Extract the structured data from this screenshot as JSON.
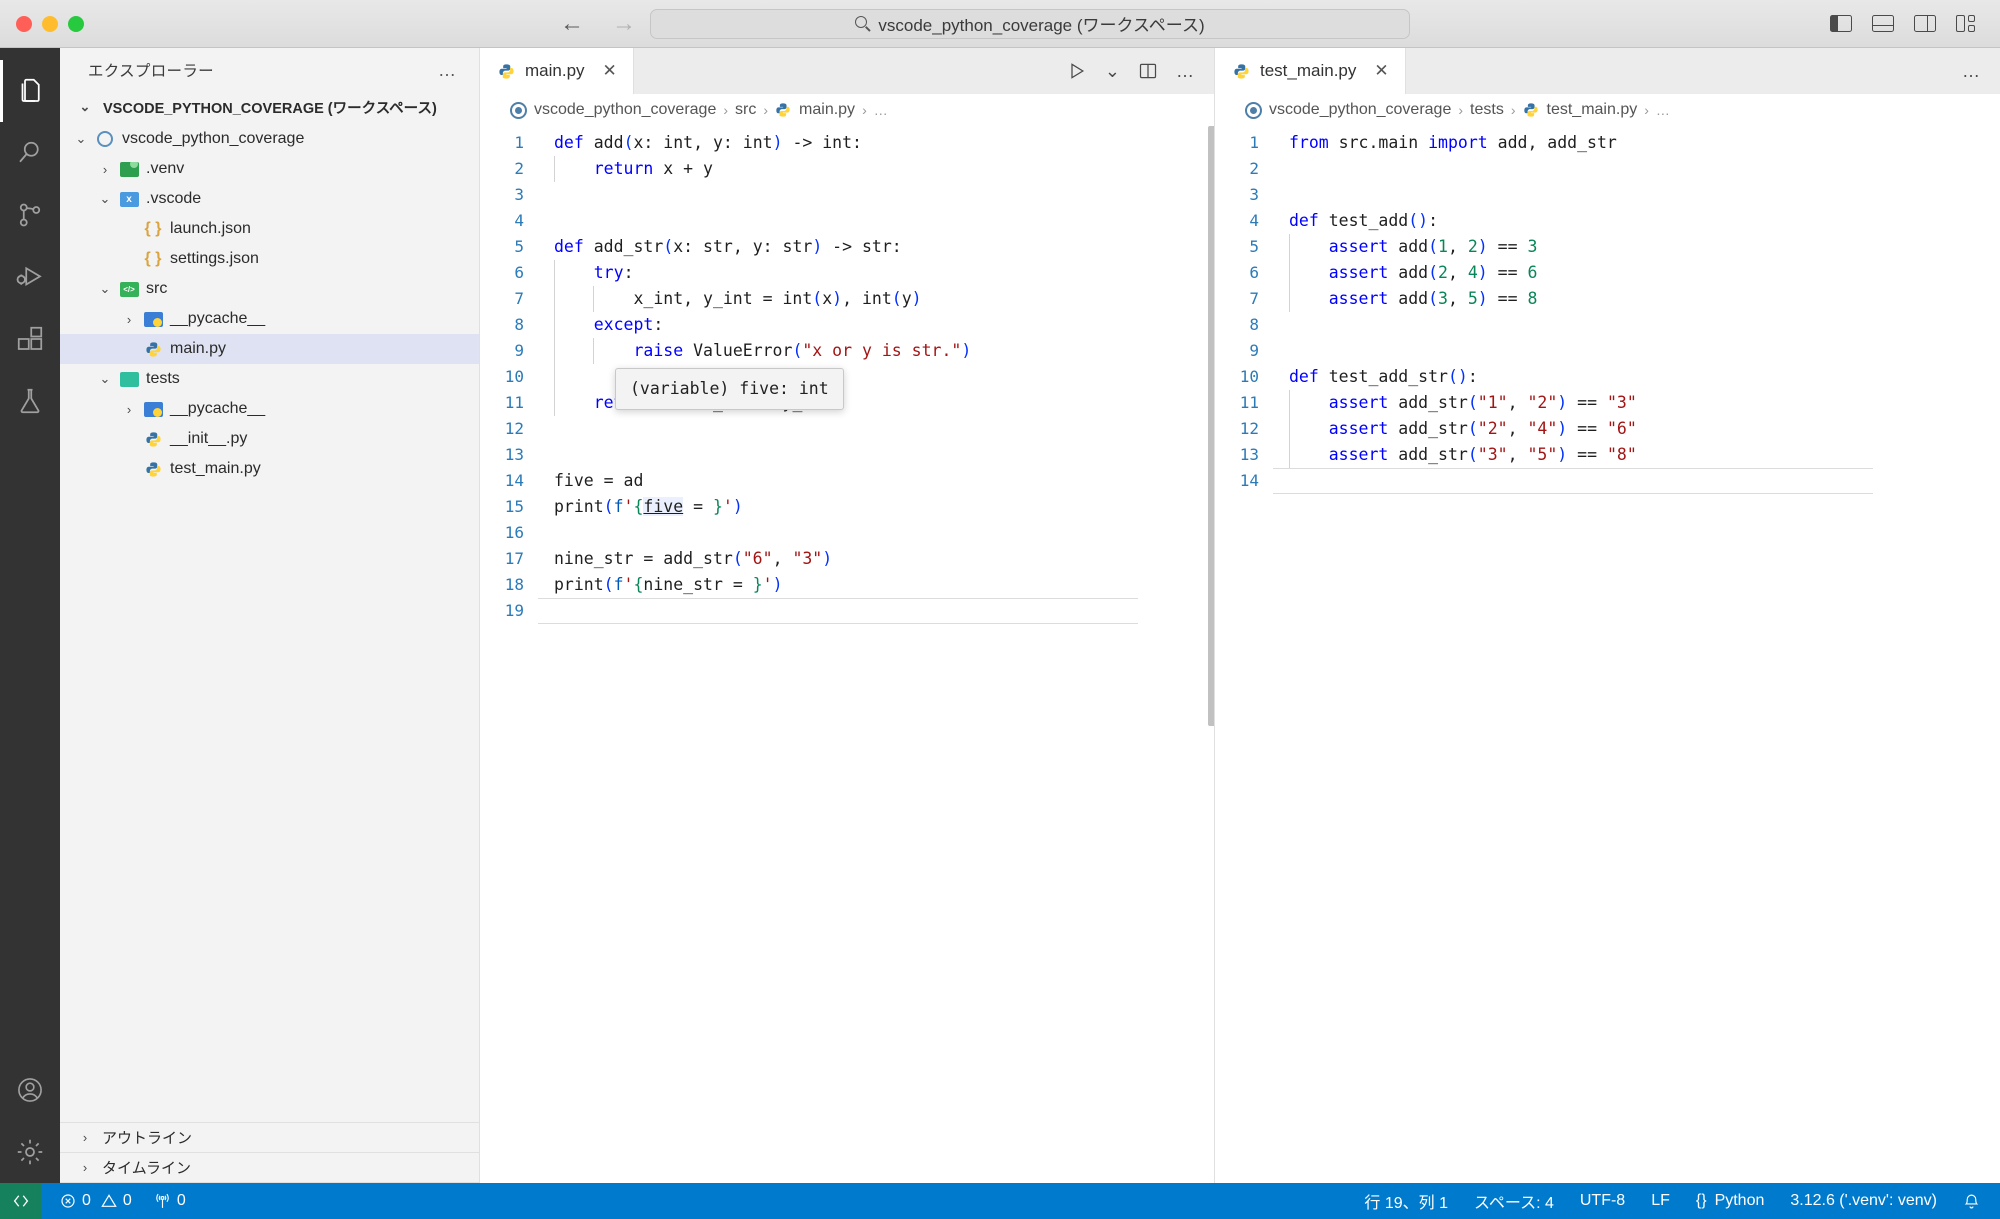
{
  "titlebar": {
    "search_text": "vscode_python_coverage (ワークスペース)",
    "back_label": "←",
    "forward_label": "→",
    "layout_icons": [
      "toggle-primary-sidebar",
      "toggle-panel",
      "toggle-secondary-sidebar",
      "customize-layout"
    ]
  },
  "activitybar": {
    "items": [
      {
        "name": "explorer",
        "active": true
      },
      {
        "name": "search",
        "active": false
      },
      {
        "name": "source-control",
        "active": false
      },
      {
        "name": "run-and-debug",
        "active": false
      },
      {
        "name": "extensions",
        "active": false
      },
      {
        "name": "testing",
        "active": false
      }
    ],
    "bottom": [
      {
        "name": "accounts"
      },
      {
        "name": "manage-settings"
      }
    ]
  },
  "sidebar": {
    "title": "エクスプローラー",
    "more_label": "…",
    "workspace_root": "VSCODE_PYTHON_COVERAGE (ワークスペース)",
    "tree": [
      {
        "label": "vscode_python_coverage",
        "icon": "folder-circle",
        "indent": 1,
        "chevron": "▾",
        "selected": false
      },
      {
        "label": ".venv",
        "icon": "folder-venv",
        "indent": 2,
        "chevron": "›",
        "selected": false
      },
      {
        "label": ".vscode",
        "icon": "folder-vscode",
        "indent": 2,
        "chevron": "▾",
        "selected": false
      },
      {
        "label": "launch.json",
        "icon": "json-braces",
        "indent": 3,
        "chevron": "",
        "selected": false
      },
      {
        "label": "settings.json",
        "icon": "json-braces",
        "indent": 3,
        "chevron": "",
        "selected": false
      },
      {
        "label": "src",
        "icon": "folder-src",
        "indent": 2,
        "chevron": "▾",
        "selected": false
      },
      {
        "label": "__pycache__",
        "icon": "folder-pycache",
        "indent": 3,
        "chevron": "›",
        "selected": false
      },
      {
        "label": "main.py",
        "icon": "python-file",
        "indent": 3,
        "chevron": "",
        "selected": true
      },
      {
        "label": "tests",
        "icon": "folder-tests",
        "indent": 2,
        "chevron": "▾",
        "selected": false
      },
      {
        "label": "__pycache__",
        "icon": "folder-pycache",
        "indent": 3,
        "chevron": "›",
        "selected": false
      },
      {
        "label": "__init__.py",
        "icon": "python-file",
        "indent": 3,
        "chevron": "",
        "selected": false
      },
      {
        "label": "test_main.py",
        "icon": "python-file",
        "indent": 3,
        "chevron": "",
        "selected": false
      }
    ],
    "sections": [
      {
        "label": "アウトライン",
        "chevron": "›"
      },
      {
        "label": "タイムライン",
        "chevron": "›"
      }
    ]
  },
  "editor_groups": [
    {
      "tab": {
        "label": "main.py",
        "icon": "python-file",
        "close": "✕"
      },
      "actions": {
        "run": "run-python-file",
        "run_chevron": "⌄",
        "split": "split-editor",
        "more": "…"
      },
      "breadcrumb": [
        "vscode_python_coverage",
        "src",
        "main.py",
        "…"
      ],
      "tooltip": "(variable) five: int",
      "lines": [
        {
          "n": "1",
          "tokens": [
            {
              "t": "def",
              "c": "kw"
            },
            {
              "t": " add",
              "c": "plain"
            },
            {
              "t": "(",
              "c": "paren"
            },
            {
              "t": "x: int, y: int",
              "c": "plain"
            },
            {
              "t": ")",
              "c": "paren"
            },
            {
              "t": " -> int:",
              "c": "plain"
            }
          ]
        },
        {
          "n": "2",
          "indent": 1,
          "tokens": [
            {
              "t": "    ",
              "c": "plain"
            },
            {
              "t": "return",
              "c": "kw"
            },
            {
              "t": " x + y",
              "c": "plain"
            }
          ]
        },
        {
          "n": "3",
          "tokens": []
        },
        {
          "n": "4",
          "tokens": []
        },
        {
          "n": "5",
          "tokens": [
            {
              "t": "def",
              "c": "kw"
            },
            {
              "t": " add_str",
              "c": "plain"
            },
            {
              "t": "(",
              "c": "paren"
            },
            {
              "t": "x: str, y: str",
              "c": "plain"
            },
            {
              "t": ")",
              "c": "paren"
            },
            {
              "t": " -> str:",
              "c": "plain"
            }
          ]
        },
        {
          "n": "6",
          "indent": 1,
          "tokens": [
            {
              "t": "    ",
              "c": "plain"
            },
            {
              "t": "try",
              "c": "kw"
            },
            {
              "t": ":",
              "c": "plain"
            }
          ]
        },
        {
          "n": "7",
          "indent": 2,
          "tokens": [
            {
              "t": "        x_int, y_int = int",
              "c": "plain"
            },
            {
              "t": "(",
              "c": "paren"
            },
            {
              "t": "x",
              "c": "plain"
            },
            {
              "t": ")",
              "c": "paren"
            },
            {
              "t": ", int",
              "c": "plain"
            },
            {
              "t": "(",
              "c": "paren"
            },
            {
              "t": "y",
              "c": "plain"
            },
            {
              "t": ")",
              "c": "paren"
            }
          ]
        },
        {
          "n": "8",
          "indent": 1,
          "tokens": [
            {
              "t": "    ",
              "c": "plain"
            },
            {
              "t": "except",
              "c": "kw"
            },
            {
              "t": ":",
              "c": "plain"
            }
          ]
        },
        {
          "n": "9",
          "indent": 2,
          "tokens": [
            {
              "t": "        ",
              "c": "plain"
            },
            {
              "t": "raise",
              "c": "kw"
            },
            {
              "t": " ValueError",
              "c": "plain"
            },
            {
              "t": "(",
              "c": "paren"
            },
            {
              "t": "\"x or y is str.\"",
              "c": "str"
            },
            {
              "t": ")",
              "c": "paren"
            }
          ]
        },
        {
          "n": "10",
          "indent": 1,
          "tokens": []
        },
        {
          "n": "11",
          "indent": 1,
          "tokens": [
            {
              "t": "    ",
              "c": "plain"
            },
            {
              "t": "return",
              "c": "kw"
            },
            {
              "t": " str",
              "c": "plain"
            },
            {
              "t": "(",
              "c": "paren"
            },
            {
              "t": "x_int + y_int",
              "c": "plain"
            },
            {
              "t": ")",
              "c": "paren"
            }
          ]
        },
        {
          "n": "12",
          "tokens": []
        },
        {
          "n": "13",
          "tokens": []
        },
        {
          "n": "14",
          "tokens": [
            {
              "t": "five = ad",
              "c": "plain"
            }
          ]
        },
        {
          "n": "15",
          "tokens": [
            {
              "t": "print",
              "c": "plain"
            },
            {
              "t": "(",
              "c": "paren"
            },
            {
              "t": "f",
              "c": "kw2"
            },
            {
              "t": "'",
              "c": "str"
            },
            {
              "t": "{",
              "c": "fstr-brace"
            },
            {
              "t": "five",
              "c": "var-u"
            },
            {
              "t": " = ",
              "c": "plain"
            },
            {
              "t": "}",
              "c": "fstr-brace"
            },
            {
              "t": "'",
              "c": "str"
            },
            {
              "t": ")",
              "c": "paren"
            }
          ]
        },
        {
          "n": "16",
          "tokens": []
        },
        {
          "n": "17",
          "tokens": [
            {
              "t": "nine_str = add_str",
              "c": "plain"
            },
            {
              "t": "(",
              "c": "paren"
            },
            {
              "t": "\"6\"",
              "c": "str"
            },
            {
              "t": ", ",
              "c": "plain"
            },
            {
              "t": "\"3\"",
              "c": "str"
            },
            {
              "t": ")",
              "c": "paren"
            }
          ]
        },
        {
          "n": "18",
          "tokens": [
            {
              "t": "print",
              "c": "plain"
            },
            {
              "t": "(",
              "c": "paren"
            },
            {
              "t": "f",
              "c": "kw2"
            },
            {
              "t": "'",
              "c": "str"
            },
            {
              "t": "{",
              "c": "fstr-brace"
            },
            {
              "t": "nine_str",
              "c": "plain"
            },
            {
              "t": " = ",
              "c": "plain"
            },
            {
              "t": "}",
              "c": "fstr-brace"
            },
            {
              "t": "'",
              "c": "str"
            },
            {
              "t": ")",
              "c": "paren"
            }
          ]
        },
        {
          "n": "19",
          "tokens": [],
          "cursor": true
        }
      ]
    },
    {
      "tab": {
        "label": "test_main.py",
        "icon": "python-file",
        "close": "✕"
      },
      "actions": {
        "more": "…"
      },
      "breadcrumb": [
        "vscode_python_coverage",
        "tests",
        "test_main.py",
        "…"
      ],
      "lines": [
        {
          "n": "1",
          "tokens": [
            {
              "t": "from",
              "c": "kw"
            },
            {
              "t": " src.main ",
              "c": "plain"
            },
            {
              "t": "import",
              "c": "kw"
            },
            {
              "t": " add, add_str",
              "c": "plain"
            }
          ]
        },
        {
          "n": "2",
          "tokens": []
        },
        {
          "n": "3",
          "tokens": []
        },
        {
          "n": "4",
          "tokens": [
            {
              "t": "def",
              "c": "kw"
            },
            {
              "t": " test_add",
              "c": "plain"
            },
            {
              "t": "()",
              "c": "paren"
            },
            {
              "t": ":",
              "c": "plain"
            }
          ]
        },
        {
          "n": "5",
          "indent": 1,
          "tokens": [
            {
              "t": "    ",
              "c": "plain"
            },
            {
              "t": "assert",
              "c": "kw"
            },
            {
              "t": " add",
              "c": "plain"
            },
            {
              "t": "(",
              "c": "paren"
            },
            {
              "t": "1",
              "c": "num"
            },
            {
              "t": ", ",
              "c": "plain"
            },
            {
              "t": "2",
              "c": "num"
            },
            {
              "t": ")",
              "c": "paren"
            },
            {
              "t": " == ",
              "c": "plain"
            },
            {
              "t": "3",
              "c": "num"
            }
          ]
        },
        {
          "n": "6",
          "indent": 1,
          "tokens": [
            {
              "t": "    ",
              "c": "plain"
            },
            {
              "t": "assert",
              "c": "kw"
            },
            {
              "t": " add",
              "c": "plain"
            },
            {
              "t": "(",
              "c": "paren"
            },
            {
              "t": "2",
              "c": "num"
            },
            {
              "t": ", ",
              "c": "plain"
            },
            {
              "t": "4",
              "c": "num"
            },
            {
              "t": ")",
              "c": "paren"
            },
            {
              "t": " == ",
              "c": "plain"
            },
            {
              "t": "6",
              "c": "num"
            }
          ]
        },
        {
          "n": "7",
          "indent": 1,
          "tokens": [
            {
              "t": "    ",
              "c": "plain"
            },
            {
              "t": "assert",
              "c": "kw"
            },
            {
              "t": " add",
              "c": "plain"
            },
            {
              "t": "(",
              "c": "paren"
            },
            {
              "t": "3",
              "c": "num"
            },
            {
              "t": ", ",
              "c": "plain"
            },
            {
              "t": "5",
              "c": "num"
            },
            {
              "t": ")",
              "c": "paren"
            },
            {
              "t": " == ",
              "c": "plain"
            },
            {
              "t": "8",
              "c": "num"
            }
          ]
        },
        {
          "n": "8",
          "tokens": []
        },
        {
          "n": "9",
          "tokens": []
        },
        {
          "n": "10",
          "tokens": [
            {
              "t": "def",
              "c": "kw"
            },
            {
              "t": " test_add_str",
              "c": "plain"
            },
            {
              "t": "()",
              "c": "paren"
            },
            {
              "t": ":",
              "c": "plain"
            }
          ]
        },
        {
          "n": "11",
          "indent": 1,
          "tokens": [
            {
              "t": "    ",
              "c": "plain"
            },
            {
              "t": "assert",
              "c": "kw"
            },
            {
              "t": " add_str",
              "c": "plain"
            },
            {
              "t": "(",
              "c": "paren"
            },
            {
              "t": "\"1\"",
              "c": "str"
            },
            {
              "t": ", ",
              "c": "plain"
            },
            {
              "t": "\"2\"",
              "c": "str"
            },
            {
              "t": ")",
              "c": "paren"
            },
            {
              "t": " == ",
              "c": "plain"
            },
            {
              "t": "\"3\"",
              "c": "str"
            }
          ]
        },
        {
          "n": "12",
          "indent": 1,
          "tokens": [
            {
              "t": "    ",
              "c": "plain"
            },
            {
              "t": "assert",
              "c": "kw"
            },
            {
              "t": " add_str",
              "c": "plain"
            },
            {
              "t": "(",
              "c": "paren"
            },
            {
              "t": "\"2\"",
              "c": "str"
            },
            {
              "t": ", ",
              "c": "plain"
            },
            {
              "t": "\"4\"",
              "c": "str"
            },
            {
              "t": ")",
              "c": "paren"
            },
            {
              "t": " == ",
              "c": "plain"
            },
            {
              "t": "\"6\"",
              "c": "str"
            }
          ]
        },
        {
          "n": "13",
          "indent": 1,
          "tokens": [
            {
              "t": "    ",
              "c": "plain"
            },
            {
              "t": "assert",
              "c": "kw"
            },
            {
              "t": " add_str",
              "c": "plain"
            },
            {
              "t": "(",
              "c": "paren"
            },
            {
              "t": "\"3\"",
              "c": "str"
            },
            {
              "t": ", ",
              "c": "plain"
            },
            {
              "t": "\"5\"",
              "c": "str"
            },
            {
              "t": ")",
              "c": "paren"
            },
            {
              "t": " == ",
              "c": "plain"
            },
            {
              "t": "\"8\"",
              "c": "str"
            }
          ]
        },
        {
          "n": "14",
          "tokens": [],
          "cursor": true
        }
      ]
    }
  ],
  "statusbar": {
    "remote_icon": "remote-window",
    "errors": "0",
    "warnings": "0",
    "ports": "0",
    "right": {
      "cursor_position": "行 19、列 1",
      "indentation": "スペース: 4",
      "encoding": "UTF-8",
      "eol": "LF",
      "language": "Python",
      "interpreter": "3.12.6 ('.venv': venv)",
      "bell_icon": "notifications-bell"
    }
  },
  "colors": {
    "accent": "#007acc",
    "remote_green": "#16825d",
    "activity_bg": "#333333",
    "sidebar_bg": "#f3f3f3",
    "selection": "#dfe2f2"
  }
}
